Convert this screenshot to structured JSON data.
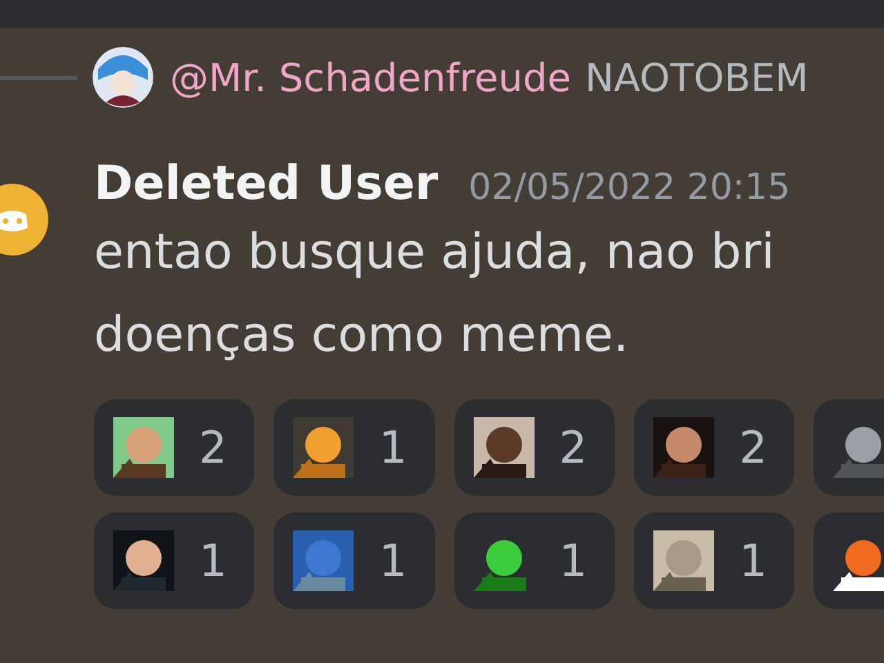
{
  "reply": {
    "username": "@Mr. Schadenfreude",
    "preview": "NAOTOBEM"
  },
  "message": {
    "author": "Deleted User",
    "timestamp": "02/05/2022 20:15",
    "lines": [
      "entao busque ajuda, nao bri",
      "doenças como meme."
    ]
  },
  "reaction_rows": [
    {
      "reactions": [
        {
          "emoji": {
            "kind": "picture"
          },
          "count": "2"
        },
        {
          "emoji": {
            "kind": "picture"
          },
          "count": "1"
        },
        {
          "emoji": {
            "kind": "picture"
          },
          "count": "2"
        },
        {
          "emoji": {
            "kind": "picture"
          },
          "count": "2"
        },
        {
          "emoji": {
            "kind": "picture"
          }
        }
      ]
    },
    {
      "reactions": [
        {
          "emoji": {
            "kind": "picture"
          },
          "count": "1"
        },
        {
          "emoji": {
            "kind": "picture"
          },
          "count": "1"
        },
        {
          "emoji": {
            "kind": "picture"
          },
          "count": "1"
        },
        {
          "emoji": {
            "kind": "picture"
          },
          "count": "1"
        },
        {
          "emoji": {
            "kind": "picture"
          }
        }
      ]
    }
  ]
}
